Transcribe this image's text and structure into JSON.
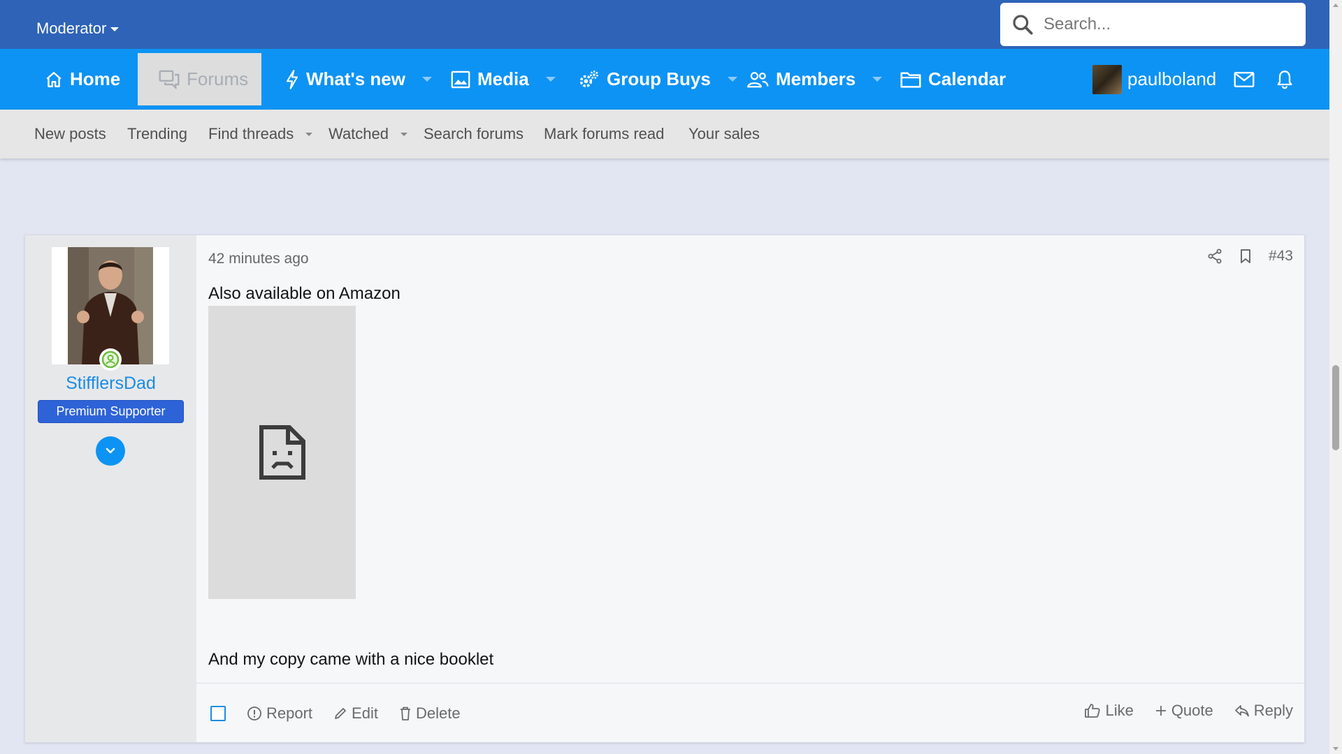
{
  "topbar": {
    "moderator_label": "Moderator",
    "search_placeholder": "Search..."
  },
  "nav": {
    "home": "Home",
    "forums": "Forums",
    "whats_new": "What's new",
    "media": "Media",
    "group_buys": "Group Buys",
    "members": "Members",
    "calendar": "Calendar",
    "username": "paulboland"
  },
  "subnav": {
    "new_posts": "New posts",
    "trending": "Trending",
    "find_threads": "Find threads",
    "watched": "Watched",
    "search_forums": "Search forums",
    "mark_forums_read": "Mark forums read",
    "your_sales": "Your sales"
  },
  "post": {
    "author": "StifflersDad",
    "user_title": "Premium Supporter",
    "time": "42 minutes ago",
    "number": "#43",
    "line1": "Also available on Amazon",
    "line2": "And my copy came with a nice booklet",
    "actions": {
      "report": "Report",
      "edit": "Edit",
      "delete": "Delete",
      "like": "Like",
      "quote": "Quote",
      "reply": "Reply"
    }
  },
  "colors": {
    "topbar": "#2e63b8",
    "navbar": "#0d93f4",
    "accent": "#1a8ce6",
    "badge": "#2e63d8"
  }
}
